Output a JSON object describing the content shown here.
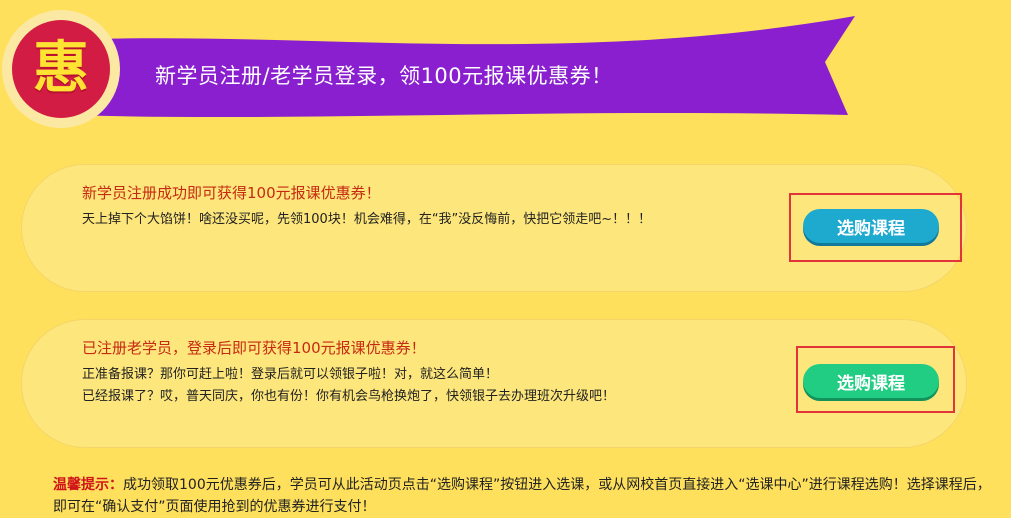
{
  "banner": {
    "badge_char": "惠",
    "title": "新学员注册/老学员登录，领100元报课优惠券！",
    "badge_color": "#d31c44",
    "ribbon_color": "#8a1fcf"
  },
  "cards": [
    {
      "title": "新学员注册成功即可获得100元报课优惠券！",
      "lines": [
        "天上掉下个大馅饼！啥还没买呢，先领100块！机会难得，在“我”没反悔前，快把它领走吧~！！！"
      ],
      "button_label": "选购课程",
      "button_color": "#1ea9cf"
    },
    {
      "title": "已注册老学员，登录后即可获得100元报课优惠券！",
      "lines": [
        "正准备报课？那你可赶上啦！登录后就可以领银子啦！对，就这么简单！",
        "已经报课了？哎，普天同庆，你也有份！你有机会鸟枪换炮了，快领银子去办理班次升级吧！"
      ],
      "button_label": "选购课程",
      "button_color": "#21cc83"
    }
  ],
  "tip": {
    "label": "温馨提示：",
    "text": "成功领取100元优惠券后，学员可从此活动页点击“选购课程”按钮进入选课，或从网校首页直接进入“选课中心”进行课程选购！选择课程后，即可在“确认支付”页面使用抢到的优惠券进行支付！"
  }
}
